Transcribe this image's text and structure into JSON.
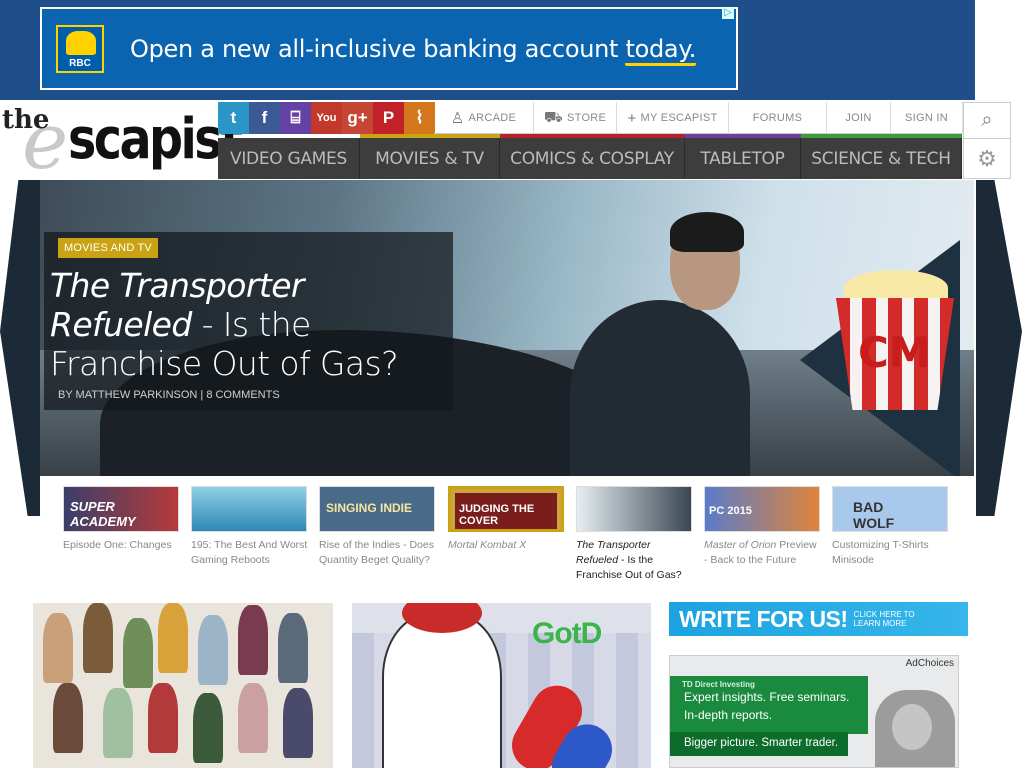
{
  "top_ad": {
    "logo_text": "RBC",
    "headline_prefix": "Open a new all-inclusive banking account",
    "headline_highlight": "today.",
    "colors": {
      "background": "#0a64b0",
      "accent": "#ffd200"
    }
  },
  "logo": {
    "the": "the",
    "e": "e",
    "scapist": "scapist"
  },
  "social": [
    {
      "icon": "twitter-icon",
      "glyph": "t"
    },
    {
      "icon": "facebook-icon",
      "glyph": "f"
    },
    {
      "icon": "twitch-icon",
      "glyph": "⌸"
    },
    {
      "icon": "youtube-icon",
      "glyph": "You"
    },
    {
      "icon": "google-plus-icon",
      "glyph": "g+"
    },
    {
      "icon": "pinterest-icon",
      "glyph": "P"
    },
    {
      "icon": "rss-icon",
      "glyph": "⌇"
    }
  ],
  "top_nav": {
    "arcade": "ARCADE",
    "store": "STORE",
    "my_escapist": "MY ESCAPIST",
    "forums": "FORUMS",
    "join": "JOIN",
    "sign_in": "SIGN IN"
  },
  "main_nav": [
    {
      "label": "VIDEO GAMES",
      "color": "#3aa1d8"
    },
    {
      "label": "MOVIES & TV",
      "color": "#c9a314"
    },
    {
      "label": "COMICS & COSPLAY",
      "color": "#b5222c"
    },
    {
      "label": "TABLETOP",
      "color": "#6b3fa0"
    },
    {
      "label": "SCIENCE & TECH",
      "color": "#3a9d3a"
    }
  ],
  "hero": {
    "category": "MOVIES AND TV",
    "title_italic": "The Transporter Refueled",
    "title_rest": "- Is the Franchise Out of Gas?",
    "byline": "BY MATTHEW PARKINSON | 8 COMMENTS",
    "badge": "CM"
  },
  "thumbs": [
    {
      "caption": "Episode One: Changes",
      "italic": false
    },
    {
      "caption": "195: The Best And Worst Gaming Reboots",
      "italic": false
    },
    {
      "caption": "Rise of the Indies - Does Quantity Beget Quality?",
      "italic": false
    },
    {
      "caption": "Mortal Kombat X",
      "italic": true
    },
    {
      "caption_italic": "The Transporter Refueled",
      "caption_rest": "- Is the Franchise Out of Gas?",
      "active": true
    },
    {
      "caption_italic": "Master of Orion",
      "caption_rest": "Preview - Back to the Future"
    },
    {
      "caption": "Customizing T-Shirts Minisode",
      "italic": false
    }
  ],
  "thumb_art": {
    "t1": "SUPER ACADEMY",
    "t3": "SINGING INDIE",
    "t4": "JUDGING THE COVER",
    "t6": "PC 2015",
    "t7": "BAD WOLF"
  },
  "bottom": {
    "gotd_label": "GotD",
    "write_ad": {
      "big_a": "WRITE",
      "big_b": "FOR US!",
      "small": "CLICK HERE TO LEARN MORE"
    },
    "td_ad": {
      "adchoices": "AdChoices",
      "brand": "TD Direct Investing",
      "line1": "Expert insights. Free seminars.",
      "line2": "In-depth reports.",
      "line3": "Bigger picture. Smarter trader."
    }
  }
}
